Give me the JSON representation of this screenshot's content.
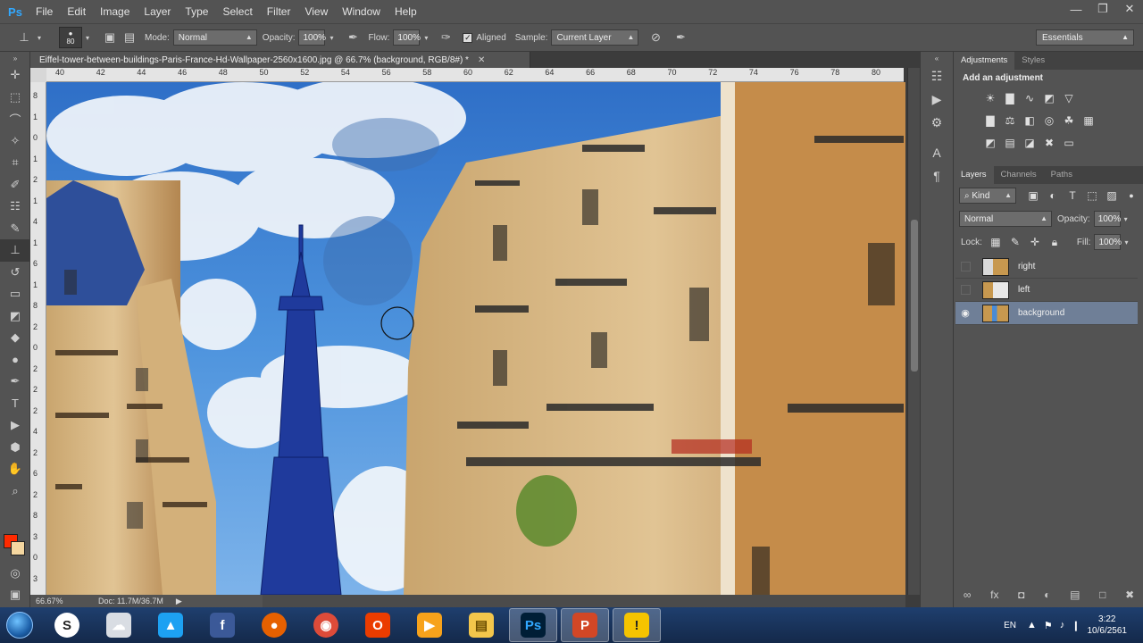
{
  "app": {
    "logo": "Ps"
  },
  "menu": [
    "File",
    "Edit",
    "Image",
    "Layer",
    "Type",
    "Select",
    "Filter",
    "View",
    "Window",
    "Help"
  ],
  "window_controls": {
    "minimize": "—",
    "restore": "❐",
    "close": "✕"
  },
  "options": {
    "brush_size": "80",
    "mode_label": "Mode:",
    "mode_value": "Normal",
    "opacity_label": "Opacity:",
    "opacity_value": "100%",
    "flow_label": "Flow:",
    "flow_value": "100%",
    "aligned_label": "Aligned",
    "aligned_checked": true,
    "sample_label": "Sample:",
    "sample_value": "Current Layer",
    "workspace": "Essentials"
  },
  "document": {
    "tab_title": "Eiffel-tower-between-buildings-Paris-France-Hd-Wallpaper-2560x1600.jpg @ 66.7% (background, RGB/8#) *",
    "ruler_top": [
      "40",
      "42",
      "44",
      "46",
      "48",
      "50",
      "52",
      "54",
      "56",
      "58",
      "60",
      "62",
      "64",
      "66",
      "68",
      "70",
      "72",
      "74",
      "76",
      "78",
      "80"
    ],
    "ruler_left": [
      "8",
      "1",
      "0",
      "1",
      "2",
      "1",
      "4",
      "1",
      "6",
      "1",
      "8",
      "2",
      "0",
      "2",
      "2",
      "2",
      "4",
      "2",
      "6",
      "2",
      "8",
      "3",
      "0",
      "3"
    ],
    "zoom": "66.67%",
    "doc_info": "Doc: 11.7M/36.7M"
  },
  "colors": {
    "foreground": "#ff2a00",
    "background": "#f5d7a0",
    "selection": "#6f7f97",
    "sky": "#4a8bd6"
  },
  "adjustments": {
    "tabs": [
      "Adjustments",
      "Styles"
    ],
    "title": "Add an adjustment",
    "row1": [
      "brightness-icon",
      "levels-icon",
      "curves-icon",
      "exposure-icon",
      "vibrance-icon"
    ],
    "row2": [
      "huesat-icon",
      "colorbalance-icon",
      "bw-icon",
      "photofilter-icon",
      "channelmixer-icon",
      "colorlookup-icon"
    ],
    "row3": [
      "invert-icon",
      "posterize-icon",
      "threshold-icon",
      "selectivecolor-icon",
      "gradientmap-icon"
    ]
  },
  "layers": {
    "tabs": [
      "Layers",
      "Channels",
      "Paths"
    ],
    "kind": "Kind",
    "blend": "Normal",
    "opacity_label": "Opacity:",
    "opacity_value": "100%",
    "lock_label": "Lock:",
    "fill_label": "Fill:",
    "fill_value": "100%",
    "items": [
      {
        "name": "right",
        "visible": false,
        "selected": false
      },
      {
        "name": "left",
        "visible": false,
        "selected": false
      },
      {
        "name": "background",
        "visible": true,
        "selected": true
      }
    ]
  },
  "taskbar": {
    "apps": [
      {
        "name": "sync",
        "label": "S"
      },
      {
        "name": "cloud",
        "label": "☁"
      },
      {
        "name": "twitter",
        "label": "▲"
      },
      {
        "name": "facebook",
        "label": "f"
      },
      {
        "name": "firefox",
        "label": "●"
      },
      {
        "name": "chrome",
        "label": "◉"
      },
      {
        "name": "office",
        "label": "O"
      },
      {
        "name": "media",
        "label": "▶"
      },
      {
        "name": "explorer",
        "label": "▤"
      },
      {
        "name": "photoshop",
        "label": "Ps"
      },
      {
        "name": "powerpoint",
        "label": "P"
      },
      {
        "name": "warning",
        "label": "!"
      }
    ],
    "lang": "EN",
    "time": "3:22",
    "date": "10/6/2561"
  }
}
